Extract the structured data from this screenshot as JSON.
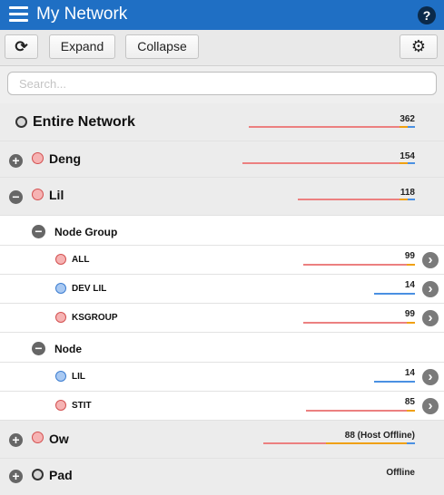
{
  "header": {
    "title": "My Network",
    "help_glyph": "?"
  },
  "toolbar": {
    "refresh_glyph": "⟳",
    "expand_label": "Expand",
    "collapse_label": "Collapse",
    "settings_glyph": "⚙"
  },
  "search": {
    "placeholder": "Search..."
  },
  "tree": {
    "root": {
      "label": "Entire Network",
      "count": "362",
      "status_color": "gray"
    },
    "deng": {
      "label": "Deng",
      "count": "154",
      "expand_glyph": "+",
      "status_color": "red"
    },
    "lil": {
      "label": "Lil",
      "count": "118",
      "collapse_glyph": "−",
      "status_color": "red"
    },
    "node_group": {
      "label": "Node Group",
      "collapse_glyph": "−"
    },
    "all": {
      "label": "ALL",
      "count": "99",
      "arrow": "›",
      "status_color": "red"
    },
    "dev_lil": {
      "label": "DEV LIL",
      "count": "14",
      "arrow": "›",
      "status_color": "blue"
    },
    "ksgroup": {
      "label": "KSGROUP",
      "count": "99",
      "arrow": "›",
      "status_color": "red"
    },
    "node": {
      "label": "Node",
      "collapse_glyph": "−"
    },
    "lil_node": {
      "label": "LIL",
      "count": "14",
      "arrow": "›",
      "status_color": "blue"
    },
    "stit": {
      "label": "STIT",
      "count": "85",
      "arrow": "›",
      "status_color": "red"
    },
    "ow": {
      "label": "Ow",
      "count": "88 (Host Offline)",
      "expand_glyph": "+",
      "status_color": "red"
    },
    "pad": {
      "label": "Pad",
      "status": "Offline",
      "expand_glyph": "+",
      "status_color": "gray"
    }
  },
  "colors": {
    "header_blue": "#1f6fc4",
    "status_red": "#ec8080",
    "status_orange": "#f0a010",
    "status_blue": "#4a90e2"
  }
}
